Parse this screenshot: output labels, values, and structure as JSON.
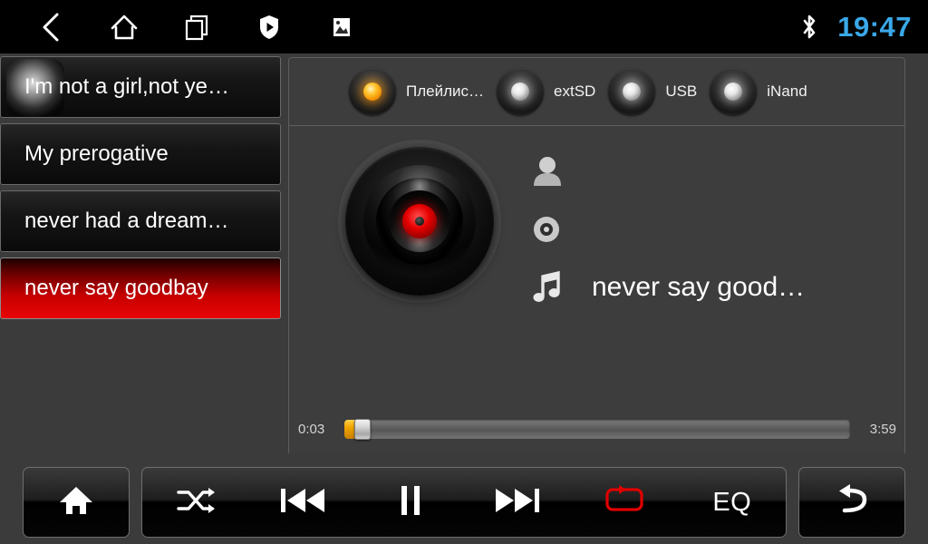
{
  "statusbar": {
    "icons": [
      {
        "name": "back-icon",
        "label": "Back"
      },
      {
        "name": "home-icon",
        "label": "Home"
      },
      {
        "name": "recent-apps-icon",
        "label": "Recent apps"
      },
      {
        "name": "shield-play-icon",
        "label": "Protected media"
      },
      {
        "name": "gallery-icon",
        "label": "Gallery"
      }
    ],
    "bluetooth_icon": "bluetooth-icon",
    "clock": "19:47",
    "clock_color": "#3aa8e8"
  },
  "playlist": {
    "items": [
      {
        "label": "I'm not a girl,not ye…",
        "selected": false,
        "ripple": true
      },
      {
        "label": "My prerogative",
        "selected": false,
        "ripple": false
      },
      {
        "label": "never had a dream…",
        "selected": false,
        "ripple": false
      },
      {
        "label": "never say goodbay",
        "selected": true,
        "ripple": false
      }
    ],
    "selected_color": "#e00000"
  },
  "sources": {
    "tabs": [
      {
        "label": "Плейлис…",
        "active": true
      },
      {
        "label": "extSD",
        "active": false
      },
      {
        "label": "USB",
        "active": false
      },
      {
        "label": "iNand",
        "active": false
      }
    ],
    "active_led_color": "#ffb000",
    "idle_led_color": "#ffffff"
  },
  "nowplaying": {
    "album_art_icon": "vinyl-record-icon",
    "artist": "",
    "album": "",
    "title": "never say good…",
    "artist_icon": "person-icon",
    "album_icon": "disc-icon",
    "title_icon": "music-note-icon"
  },
  "seek": {
    "elapsed": "0:03",
    "duration": "3:59",
    "progress_percent": 1,
    "fill_color": "#f0a500"
  },
  "controls": {
    "home": {
      "label": "Home",
      "icon": "home-filled-icon"
    },
    "shuffle": {
      "label": "Shuffle",
      "icon": "shuffle-icon",
      "active": false
    },
    "previous": {
      "label": "Previous",
      "icon": "previous-track-icon"
    },
    "playpause": {
      "label": "Pause",
      "icon": "pause-icon"
    },
    "next": {
      "label": "Next",
      "icon": "next-track-icon"
    },
    "repeat": {
      "label": "Repeat",
      "icon": "repeat-icon",
      "active": true,
      "active_color": "#e00000"
    },
    "eq": {
      "label": "EQ",
      "icon": "equalizer-label"
    },
    "back": {
      "label": "Back",
      "icon": "return-arrow-icon"
    }
  }
}
